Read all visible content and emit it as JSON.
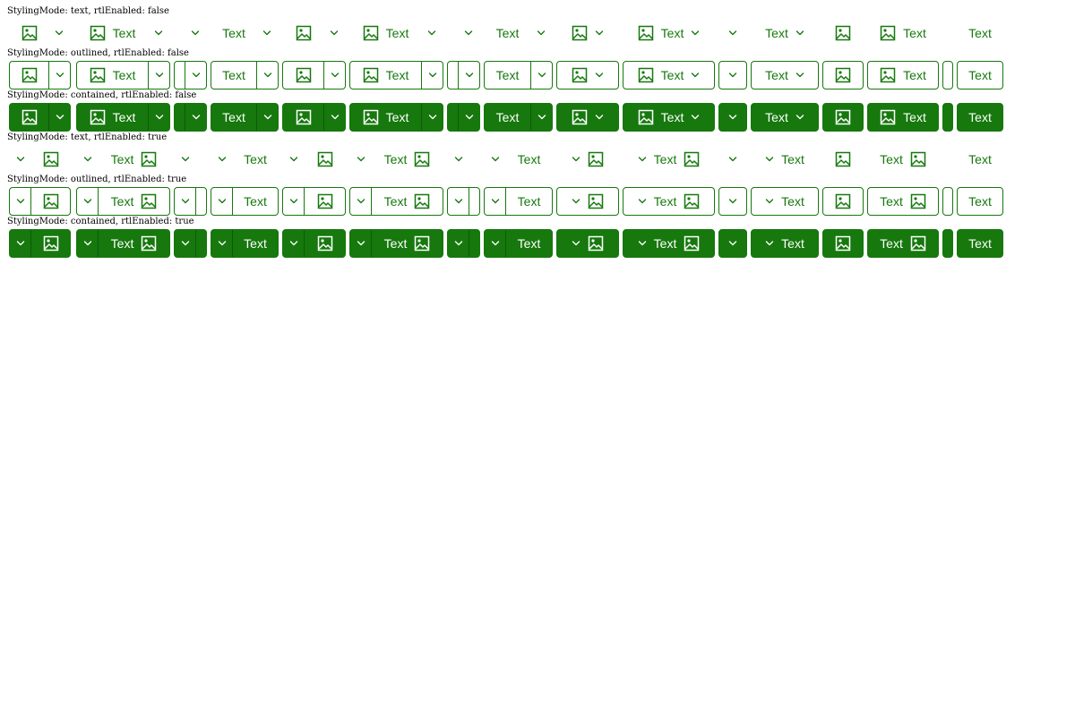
{
  "captions": [
    "StylingMode: text, rtlEnabled: false",
    "StylingMode: outlined, rtlEnabled: false",
    "StylingMode: contained, rtlEnabled: false",
    "StylingMode: text, rtlEnabled: true",
    "StylingMode: outlined, rtlEnabled: true",
    "StylingMode: contained, rtlEnabled: true"
  ],
  "button_text": "Text",
  "icons": {
    "main": "image-icon",
    "dropdown": "chevron-down-icon"
  },
  "colors": {
    "accent": "#16780d",
    "on_accent": "#ffffff",
    "background": "#ffffff"
  },
  "variants": [
    {
      "icon": true,
      "text": false,
      "split": true,
      "arrow": false
    },
    {
      "icon": true,
      "text": true,
      "split": true,
      "arrow": false
    },
    {
      "icon": false,
      "text": false,
      "split": true,
      "arrow": false
    },
    {
      "icon": false,
      "text": true,
      "split": true,
      "arrow": false
    },
    {
      "icon": true,
      "text": false,
      "split": true,
      "arrow": false
    },
    {
      "icon": true,
      "text": true,
      "split": true,
      "arrow": false
    },
    {
      "icon": false,
      "text": false,
      "split": true,
      "arrow": false
    },
    {
      "icon": false,
      "text": true,
      "split": true,
      "arrow": false
    },
    {
      "icon": true,
      "text": false,
      "split": false,
      "arrow": true
    },
    {
      "icon": true,
      "text": true,
      "split": false,
      "arrow": true
    },
    {
      "icon": false,
      "text": false,
      "split": false,
      "arrow": true
    },
    {
      "icon": false,
      "text": true,
      "split": false,
      "arrow": true
    },
    {
      "icon": true,
      "text": false,
      "split": false,
      "arrow": false
    },
    {
      "icon": true,
      "text": true,
      "split": false,
      "arrow": false
    },
    {
      "icon": false,
      "text": false,
      "split": false,
      "arrow": false
    },
    {
      "icon": false,
      "text": true,
      "split": false,
      "arrow": false
    }
  ],
  "rows": [
    {
      "mode": "text",
      "rtl": false
    },
    {
      "mode": "outlined",
      "rtl": false
    },
    {
      "mode": "contained",
      "rtl": false
    },
    {
      "mode": "text",
      "rtl": true
    },
    {
      "mode": "outlined",
      "rtl": true
    },
    {
      "mode": "contained",
      "rtl": true
    }
  ]
}
